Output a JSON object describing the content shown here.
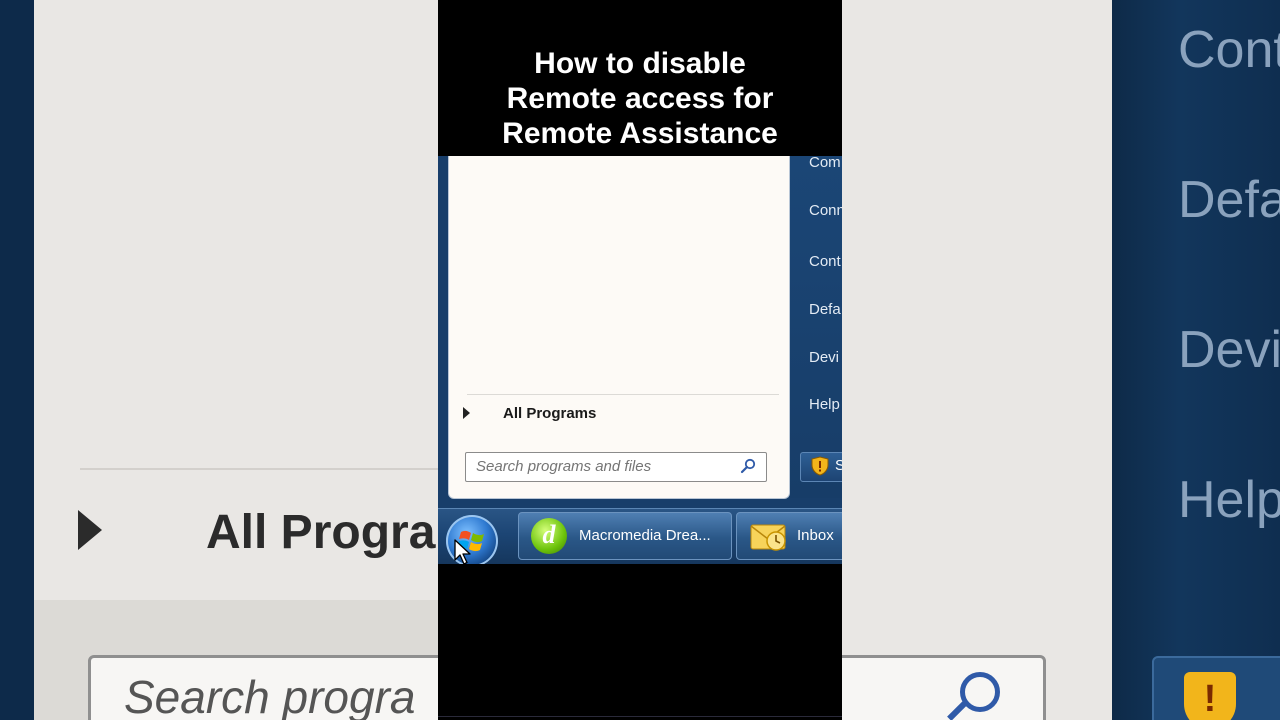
{
  "title": {
    "line1": "How to disable",
    "line2": "Remote access for",
    "line3": "Remote Assistance"
  },
  "start_menu": {
    "all_programs_label": "All Programs",
    "search_placeholder": "Search programs and files",
    "right_pane_items": [
      "Com",
      "Conn",
      "Cont",
      "Defa",
      "Devi",
      "Help"
    ],
    "shutdown_label": "S"
  },
  "taskbar": {
    "buttons": [
      {
        "label": "Macromedia Drea..."
      },
      {
        "label": "Inbox"
      }
    ]
  },
  "background": {
    "left_all_programs": "All Progra",
    "left_search_placeholder": "Search progra",
    "right_items": [
      "Cont",
      "Defa",
      "Devi",
      "Help"
    ]
  },
  "colors": {
    "start_menu_bg": "#fdfaf6",
    "right_pane_bg": "#1b4676",
    "taskbar_bg": "#1c4574",
    "title_text": "#ffffff",
    "outer_bg": "#000000"
  }
}
